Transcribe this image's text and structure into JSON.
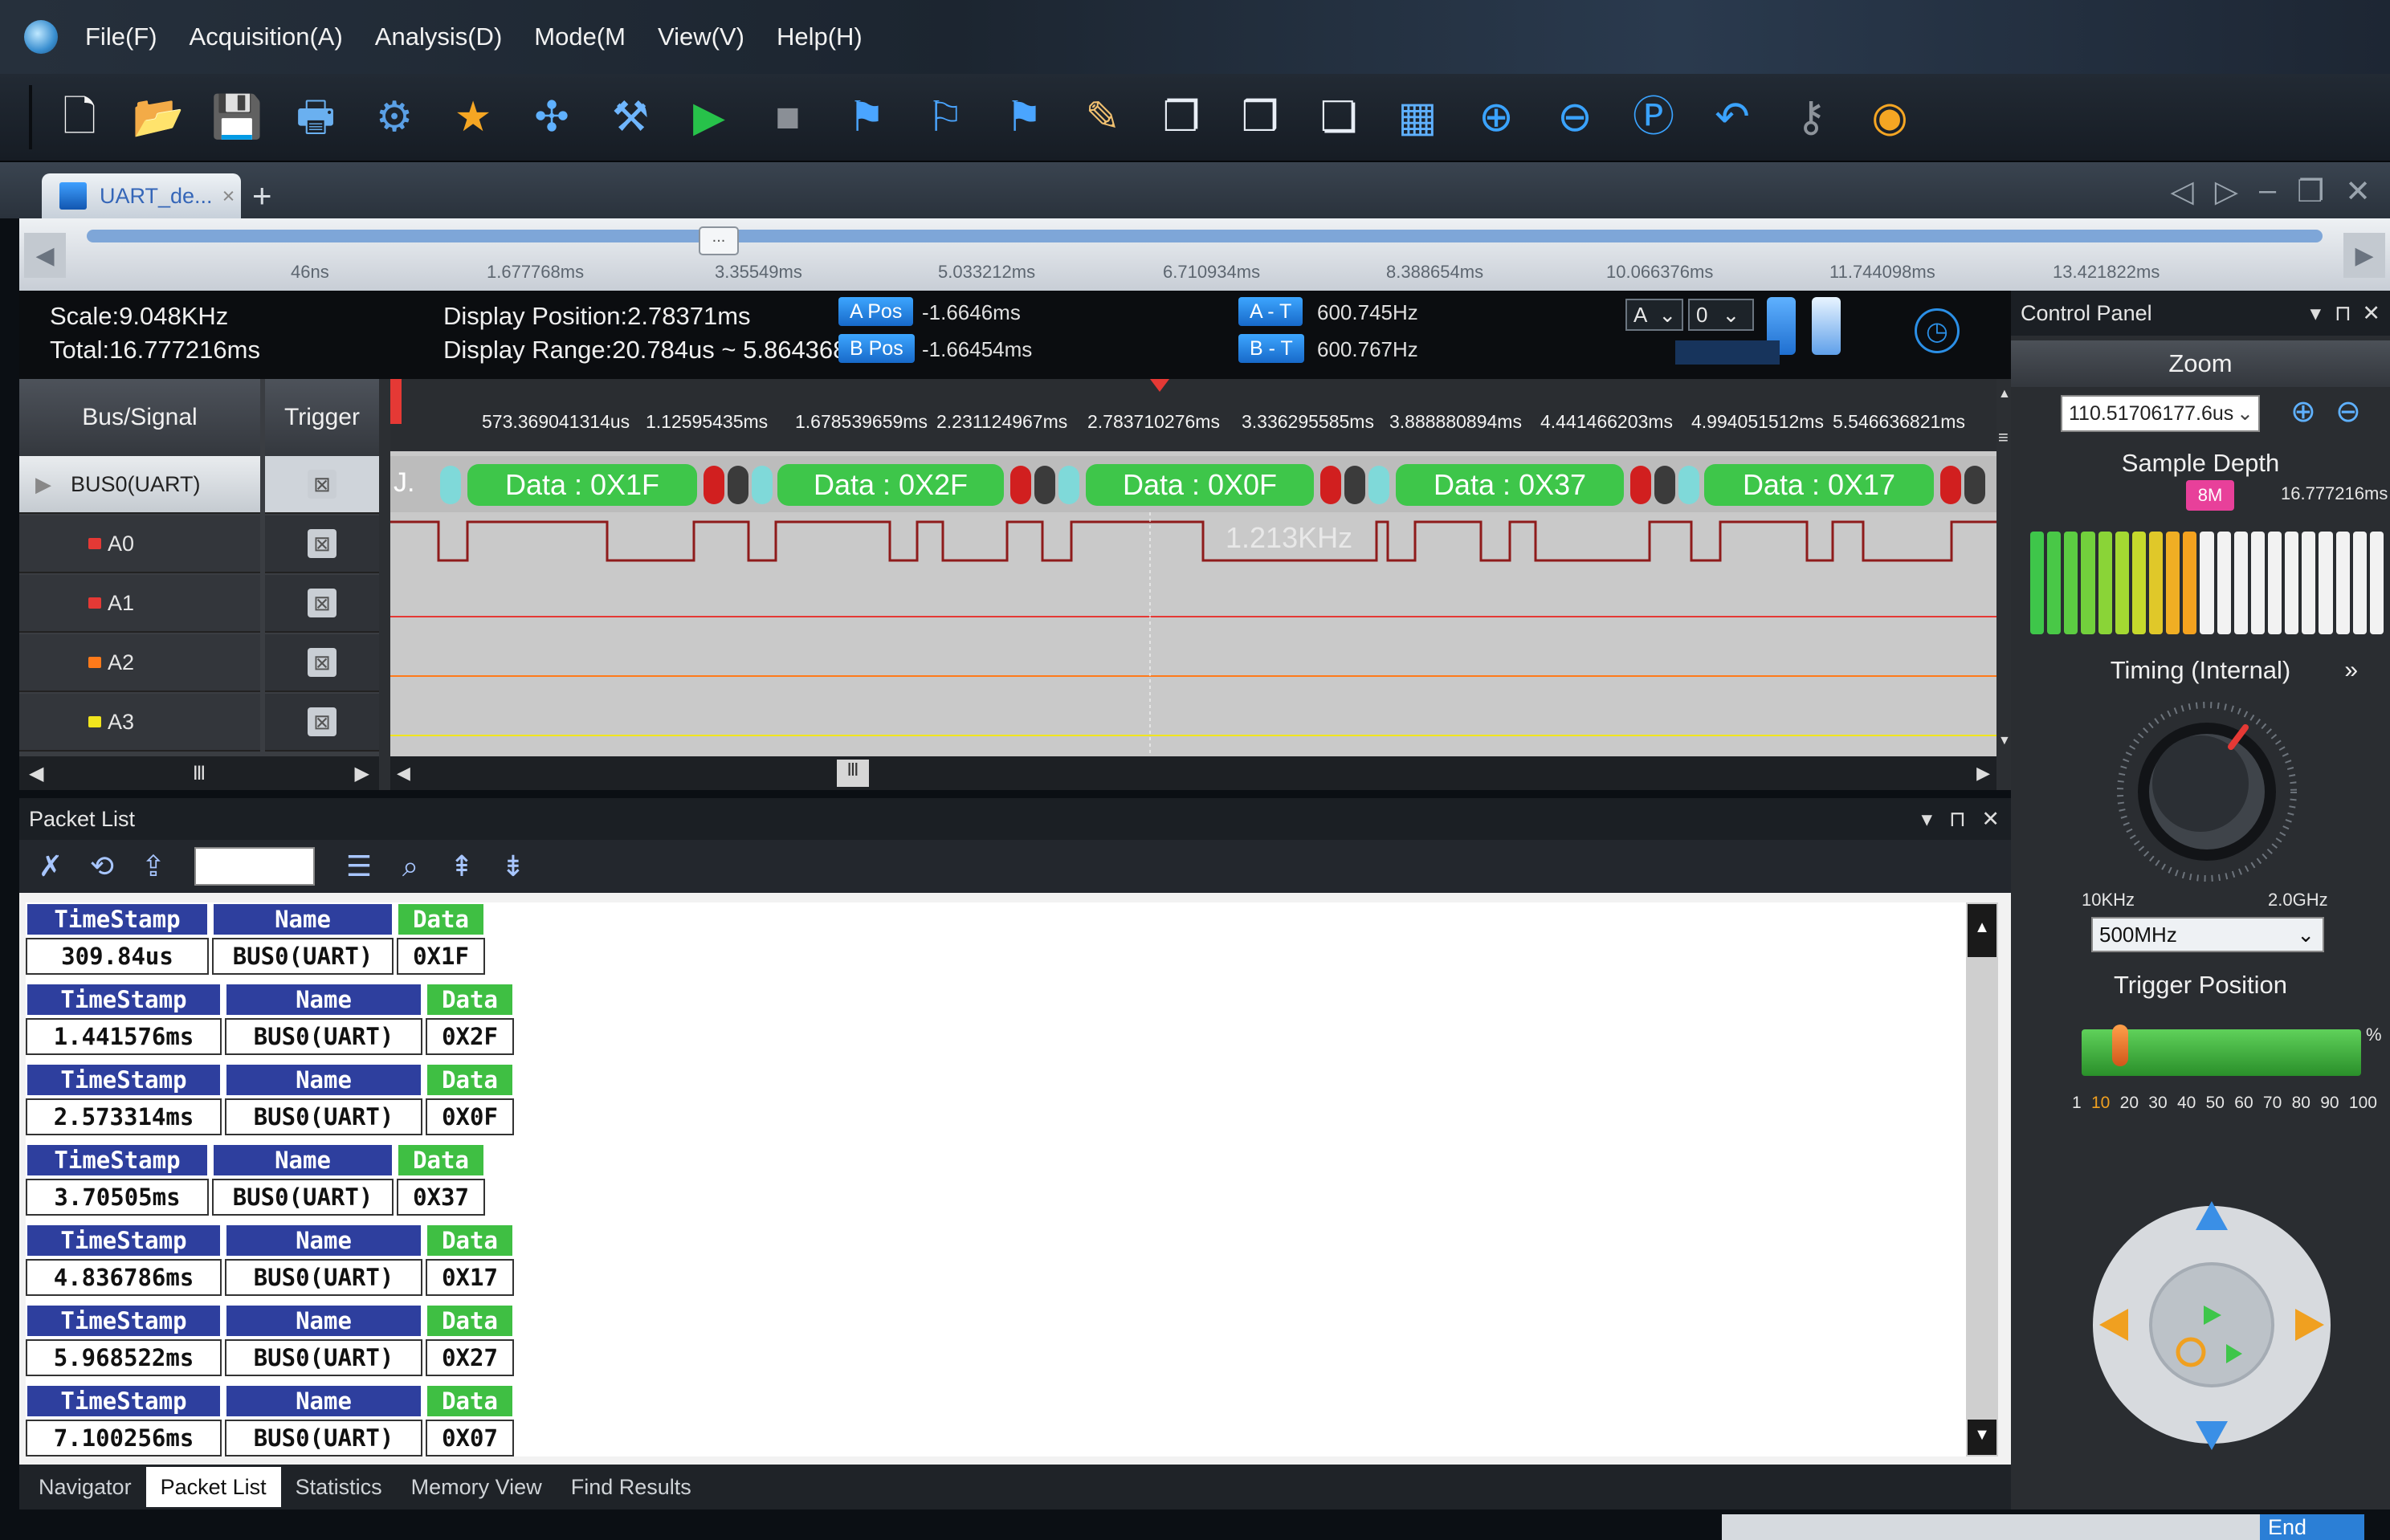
{
  "menu": [
    "File(F)",
    "Acquisition(A)",
    "Analysis(D)",
    "Mode(M",
    "View(V)",
    "Help(H)"
  ],
  "toolbar_icons": [
    "new-file-icon",
    "open-folder-icon",
    "save-icon",
    "print-icon",
    "save-settings-icon",
    "favorite-star-icon",
    "probe-icon",
    "tools-icon",
    "run-icon",
    "stop-icon",
    "add-marker-icon",
    "marker-icon",
    "goto-marker-icon",
    "flashlight-icon",
    "copy-icon",
    "paste-icon",
    "export-icon",
    "binary-view-icon",
    "zoom-in-icon",
    "zoom-out-icon",
    "zoom-fit-icon",
    "undo-zoom-icon",
    "wrench-icon",
    "lifebuoy-icon"
  ],
  "tab": {
    "label": "UART_de...",
    "close": "×",
    "add": "+"
  },
  "window_controls": [
    "◁",
    "▷",
    "–",
    "❐",
    "✕"
  ],
  "overview": {
    "thumb": "...",
    "ticks": [
      "46ns",
      "1.677768ms",
      "3.35549ms",
      "5.033212ms",
      "6.710934ms",
      "8.388654ms",
      "10.066376ms",
      "11.744098ms",
      "13.421822ms"
    ]
  },
  "info": {
    "scale": "Scale:9.048KHz",
    "total": "Total:16.777216ms",
    "display_position": "Display Position:2.78371ms",
    "display_range": "Display Range:20.784us ~ 5.864368ms",
    "a_pos_label": "A Pos",
    "a_pos_value": "-1.6646ms",
    "b_pos_label": "B Pos",
    "b_pos_value": "-1.66454ms",
    "a_t_label": "A - T",
    "a_t_value": "600.745Hz",
    "b_t_label": "B - T",
    "b_t_value": "600.767Hz",
    "select_a": "A",
    "select_0": "0"
  },
  "signals": {
    "header_bus": "Bus/Signal",
    "header_trigger": "Trigger",
    "rows": [
      {
        "name": "BUS0(UART)",
        "color": "#ffffff"
      },
      {
        "name": "A0",
        "color": "#e53935"
      },
      {
        "name": "A1",
        "color": "#e53935"
      },
      {
        "name": "A2",
        "color": "#ff7a1a"
      },
      {
        "name": "A3",
        "color": "#f1e51d"
      }
    ]
  },
  "time_ruler": [
    "573.369041314us",
    "1.12595435ms",
    "1.678539659ms",
    "2.231124967ms",
    "2.783710276ms",
    "3.336295585ms",
    "3.888880894ms",
    "4.441466203ms",
    "4.994051512ms",
    "5.546636821ms"
  ],
  "decode": {
    "prefix": "J.",
    "frames": [
      "Data : 0X1F",
      "Data : 0X2F",
      "Data : 0X0F",
      "Data : 0X37",
      "Data : 0X17"
    ]
  },
  "waveform": {
    "frequency_label": "1.213KHz",
    "colors": {
      "a0": "#8e1b1b",
      "a1": "#e53935",
      "a2": "#ff7a1a",
      "a3": "#f1e51d",
      "frame": "#3ec64a",
      "bit_red": "#d11f1f",
      "bit_dark": "#3b3b3b",
      "bit_cyan": "#7fd9d9"
    }
  },
  "packet_panel": {
    "title": "Packet List",
    "controls": [
      "▾",
      "⊓",
      "✕"
    ],
    "headers": {
      "timestamp": "TimeStamp",
      "name": "Name",
      "data": "Data"
    },
    "packets": [
      {
        "timestamp": "309.84us",
        "name": "BUS0(UART)",
        "data": "0X1F"
      },
      {
        "timestamp": "1.441576ms",
        "name": "BUS0(UART)",
        "data": "0X2F"
      },
      {
        "timestamp": "2.573314ms",
        "name": "BUS0(UART)",
        "data": "0X0F"
      },
      {
        "timestamp": "3.70505ms",
        "name": "BUS0(UART)",
        "data": "0X37"
      },
      {
        "timestamp": "4.836786ms",
        "name": "BUS0(UART)",
        "data": "0X17"
      },
      {
        "timestamp": "5.968522ms",
        "name": "BUS0(UART)",
        "data": "0X27"
      },
      {
        "timestamp": "7.100256ms",
        "name": "BUS0(UART)",
        "data": "0X07"
      }
    ]
  },
  "bottom_tabs": [
    "Navigator",
    "Packet List",
    "Statistics",
    "Memory View",
    "Find Results"
  ],
  "control_panel": {
    "title": "Control Panel",
    "zoom_title": "Zoom",
    "zoom_value": "110.51706177.6us",
    "sample_depth_title": "Sample Depth",
    "depth_badge": "8M",
    "depth_value": "16.777216ms",
    "timing_title": "Timing (Internal)",
    "knob_min": "10KHz",
    "knob_max": "2.0GHz",
    "timing_select": "500MHz",
    "trigger_title": "Trigger Position",
    "trigger_percent_symbol": "%",
    "trigger_marks": [
      "1",
      "10",
      "20",
      "30",
      "40",
      "50",
      "60",
      "70",
      "80",
      "90",
      "100"
    ],
    "trigger_position_percent": 10
  },
  "status": {
    "end_label": "End"
  }
}
